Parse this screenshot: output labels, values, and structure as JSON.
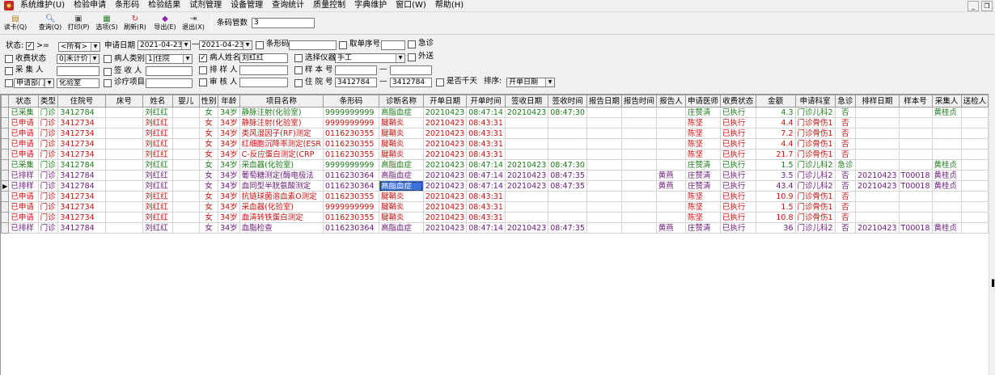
{
  "menu": [
    "系统维护(U)",
    "检验申请",
    "条形码",
    "检验结果",
    "试剂管理",
    "设备管理",
    "查询统计",
    "质量控制",
    "字典维护",
    "窗口(W)",
    "帮助(H)"
  ],
  "window_controls": [
    "_",
    "❐"
  ],
  "toolbar": {
    "buttons": [
      {
        "label": "读卡(Q)",
        "icon": "card-reader-icon"
      },
      {
        "label": "查询(Q)",
        "icon": "magnifier-icon"
      },
      {
        "label": "打印(P)",
        "icon": "printer-icon"
      },
      {
        "label": "选项(S)",
        "icon": "options-icon"
      },
      {
        "label": "刷新(R)",
        "icon": "refresh-icon"
      },
      {
        "label": "导出(E)",
        "icon": "export-icon"
      },
      {
        "label": "退出(X)",
        "icon": "exit-icon"
      }
    ],
    "barcode_count_label": "条码管数",
    "barcode_count_value": "3"
  },
  "filter": {
    "status_label": "状态:",
    "status_op": ">=",
    "status_value": "<所有>",
    "apply_date_label": "申请日期",
    "date_from": "2021-04-23",
    "date_to": "2021-04-23",
    "barcode_label": "条形码",
    "sample_take_label": "取单序号",
    "urgent_label": "急诊",
    "fee_status_label": "收费状态",
    "fee_status_value": "0|未计价",
    "patient_type_label": "病人类别",
    "patient_type_value": "1|住院",
    "patient_name_label": "病人姓名",
    "patient_name_value": "刘红红",
    "instrument_label": "选择仪器",
    "instrument_value": "手工",
    "outsourced_label": "外送",
    "collector_label": "采 集 人",
    "receiver_label": "签 收 人",
    "scheduler_label": "排 样 人",
    "sample_no_label": "样 本 号",
    "apply_dept_label": "申请部门",
    "apply_dept_value": "化验室",
    "treatment_item_label": "诊疗项目",
    "reviewer_label": "审 核 人",
    "inpatient_no_label": "住 院 号",
    "inpatient_no_from": "3412784",
    "inpatient_no_to": "3412784",
    "thousand_day_label": "是否千天",
    "sort_label": "排序:",
    "sort_value": "开单日期",
    "range_dash": "—"
  },
  "table": {
    "columns": [
      "状态",
      "类型",
      "住院号",
      "床号",
      "姓名",
      "婴儿",
      "性别",
      "年龄",
      "项目名称",
      "条形码",
      "诊断名称",
      "开单日期",
      "开单时间",
      "签收日期",
      "签收时间",
      "报告日期",
      "报告时间",
      "报告人",
      "申请医师",
      "收费状态",
      "金额",
      "申请科室",
      "急诊",
      "排样日期",
      "样本号",
      "采集人",
      "送检人"
    ],
    "colors": {
      "green": "#1b7d1b",
      "red": "#cc1111",
      "purple": "#6a1b7a"
    },
    "rows": [
      {
        "color": "green",
        "cells": [
          "已采集",
          "门诊",
          "3412784",
          "",
          "刘红红",
          "",
          "女",
          "34岁",
          "静脉注射(化验室)",
          "9999999999",
          "高脂血症",
          "20210423",
          "08:47:14",
          "20210423",
          "08:47:30",
          "",
          "",
          "",
          "庄赞清",
          "已执行",
          "4.3",
          "门诊儿科2",
          "否",
          "",
          "",
          "黄桂贞",
          ""
        ]
      },
      {
        "color": "red",
        "cells": [
          "已申请",
          "门诊",
          "3412734",
          "",
          "刘红红",
          "",
          "女",
          "34岁",
          "静脉注射(化验室)",
          "9999999999",
          "腱鞘炎",
          "20210423",
          "08:43:31",
          "",
          "",
          "",
          "",
          "",
          "陈坚",
          "已执行",
          "4.4",
          "门诊骨伤1",
          "否",
          "",
          "",
          "",
          ""
        ]
      },
      {
        "color": "red",
        "cells": [
          "已申请",
          "门诊",
          "3412734",
          "",
          "刘红红",
          "",
          "女",
          "34岁",
          "类风湿因子(RF)测定",
          "0116230355",
          "腱鞘炎",
          "20210423",
          "08:43:31",
          "",
          "",
          "",
          "",
          "",
          "陈坚",
          "已执行",
          "7.2",
          "门诊骨伤1",
          "否",
          "",
          "",
          "",
          ""
        ]
      },
      {
        "color": "red",
        "cells": [
          "已申请",
          "门诊",
          "3412734",
          "",
          "刘红红",
          "",
          "女",
          "34岁",
          "红细胞沉降率测定(ESR",
          "0116230355",
          "腱鞘炎",
          "20210423",
          "08:43:31",
          "",
          "",
          "",
          "",
          "",
          "陈坚",
          "已执行",
          "4.4",
          "门诊骨伤1",
          "否",
          "",
          "",
          "",
          ""
        ]
      },
      {
        "color": "red",
        "cells": [
          "已申请",
          "门诊",
          "3412734",
          "",
          "刘红红",
          "",
          "女",
          "34岁",
          "C-反应蛋白测定(CRP",
          "0116230355",
          "腱鞘炎",
          "20210423",
          "08:43:31",
          "",
          "",
          "",
          "",
          "",
          "陈坚",
          "已执行",
          "21.7",
          "门诊骨伤1",
          "否",
          "",
          "",
          "",
          ""
        ]
      },
      {
        "color": "green",
        "cells": [
          "已采集",
          "门诊",
          "3412784",
          "",
          "刘红红",
          "",
          "女",
          "34岁",
          "采血器(化验室)",
          "9999999999",
          "高脂血症",
          "20210423",
          "08:47:14",
          "20210423",
          "08:47:30",
          "",
          "",
          "",
          "庄赞清",
          "已执行",
          "1.5",
          "门诊儿科2",
          "急诊",
          "",
          "",
          "黄桂贞",
          ""
        ]
      },
      {
        "color": "purple",
        "cells": [
          "已排样",
          "门诊",
          "3412784",
          "",
          "刘红红",
          "",
          "女",
          "34岁",
          "葡萄糖测定(酶电极法",
          "0116230364",
          "高脂血症",
          "20210423",
          "08:47:14",
          "20210423",
          "08:47:35",
          "",
          "",
          "黄燕",
          "庄赞清",
          "已执行",
          "3.5",
          "门诊儿科2",
          "否",
          "20210423",
          "T00018",
          "黄桂贞",
          ""
        ]
      },
      {
        "color": "purple",
        "cells": [
          "已排样",
          "门诊",
          "3412784",
          "",
          "刘红红",
          "",
          "女",
          "34岁",
          "血同型半胱氨酸测定",
          "0116230364",
          "高脂血症",
          "20210423",
          "08:47:14",
          "20210423",
          "08:47:35",
          "",
          "",
          "黄燕",
          "庄赞清",
          "已执行",
          "43.4",
          "门诊儿科2",
          "否",
          "20210423",
          "T00018",
          "黄桂贞",
          ""
        ]
      },
      {
        "color": "red",
        "cells": [
          "已申请",
          "门诊",
          "3412734",
          "",
          "刘红红",
          "",
          "女",
          "34岁",
          "抗链球菌溶血素O测定",
          "0116230355",
          "腱鞘炎",
          "20210423",
          "08:43:31",
          "",
          "",
          "",
          "",
          "",
          "陈坚",
          "已执行",
          "10.9",
          "门诊骨伤1",
          "否",
          "",
          "",
          "",
          ""
        ]
      },
      {
        "color": "red",
        "cells": [
          "已申请",
          "门诊",
          "3412734",
          "",
          "刘红红",
          "",
          "女",
          "34岁",
          "采血器(化验室)",
          "9999999999",
          "腱鞘炎",
          "20210423",
          "08:43:31",
          "",
          "",
          "",
          "",
          "",
          "陈坚",
          "已执行",
          "1.5",
          "门诊骨伤1",
          "否",
          "",
          "",
          "",
          ""
        ]
      },
      {
        "color": "red",
        "cells": [
          "已申请",
          "门诊",
          "3412734",
          "",
          "刘红红",
          "",
          "女",
          "34岁",
          "血清转铁蛋白测定",
          "0116230355",
          "腱鞘炎",
          "20210423",
          "08:43:31",
          "",
          "",
          "",
          "",
          "",
          "陈坚",
          "已执行",
          "10.8",
          "门诊骨伤1",
          "否",
          "",
          "",
          "",
          ""
        ]
      },
      {
        "color": "purple",
        "cells": [
          "已排样",
          "门诊",
          "3412784",
          "",
          "刘红红",
          "",
          "女",
          "34岁",
          "血脂检查",
          "0116230364",
          "高脂血症",
          "20210423",
          "08:47:14",
          "20210423",
          "08:47:35",
          "",
          "",
          "黄燕",
          "庄赞清",
          "已执行",
          "36",
          "门诊儿科2",
          "否",
          "20210423",
          "T00018",
          "黄桂贞",
          ""
        ]
      }
    ],
    "current_row_marker": "▶"
  }
}
